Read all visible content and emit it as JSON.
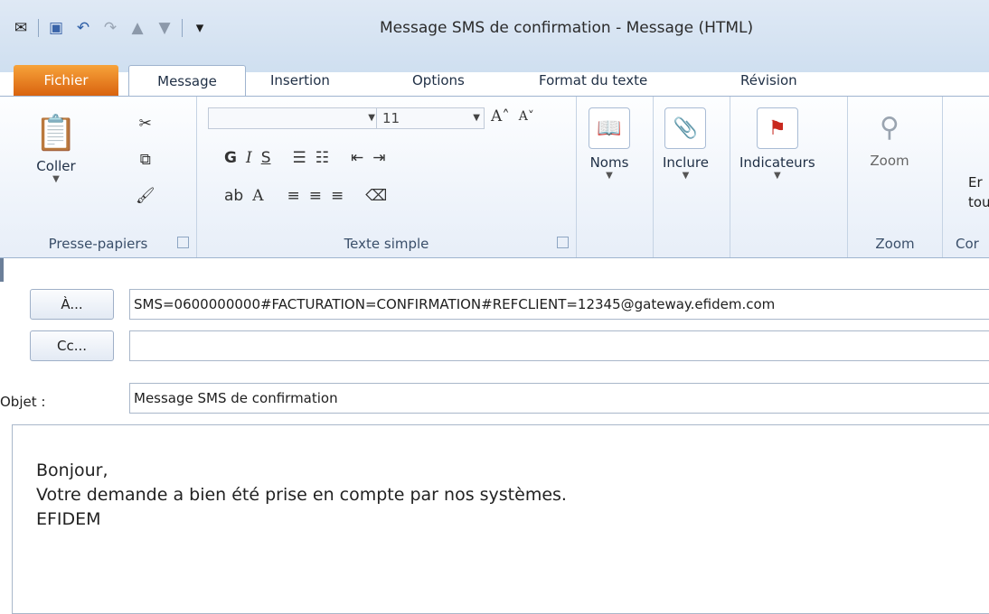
{
  "window": {
    "title": "Message SMS de confirmation  -  Message (HTML)"
  },
  "qat": {
    "icons": [
      "outlook-icon",
      "save-icon",
      "undo-icon",
      "redo-icon",
      "up-arrow-icon",
      "down-arrow-icon",
      "customize-icon"
    ],
    "customize": "▾"
  },
  "tabs": {
    "file": "Fichier",
    "message": "Message",
    "insertion": "Insertion",
    "options": "Options",
    "format": "Format du texte",
    "revision": "Révision"
  },
  "ribbon": {
    "clipboard": {
      "paste": "Coller",
      "group": "Presse-papiers"
    },
    "basic_text": {
      "font_size": "11",
      "bold": "G",
      "italic": "I",
      "underline": "S",
      "group": "Texte simple"
    },
    "names": {
      "label": "Noms"
    },
    "include": {
      "label": "Inclure"
    },
    "flags": {
      "label": "Indicateurs"
    },
    "zoom": {
      "label": "Zoom",
      "group": "Zoom"
    },
    "partial": {
      "label1": "Er",
      "label2": "tou",
      "group": "Cor"
    }
  },
  "header": {
    "to_button": "À...",
    "to_value": "SMS=0600000000#FACTURATION=CONFIRMATION#REFCLIENT=12345@gateway.efidem.com",
    "cc_button": "Cc...",
    "cc_value": "",
    "subject_label": "Objet :",
    "subject_value": "Message SMS de confirmation"
  },
  "body": {
    "line1": "Bonjour,",
    "line2": "Votre demande a bien été prise en compte par nos systèmes.",
    "line3": "EFIDEM"
  }
}
